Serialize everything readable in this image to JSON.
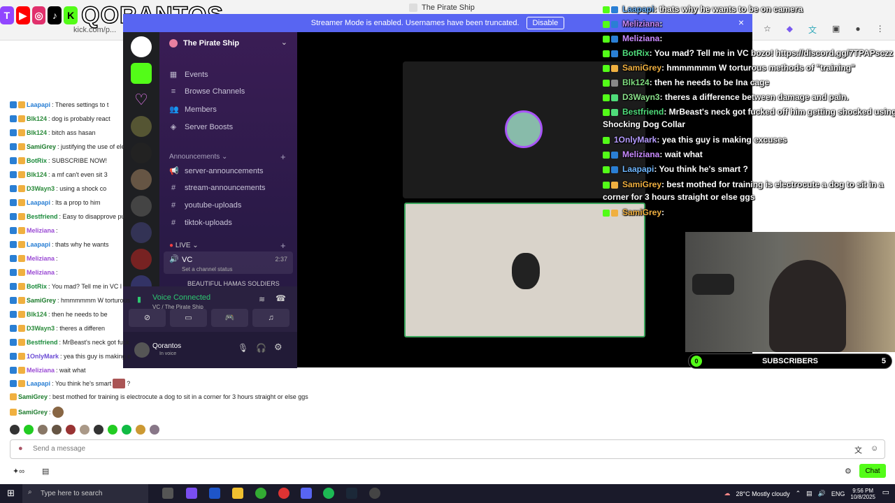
{
  "browser": {
    "url": "kick.com/p...",
    "window_title": "The Pirate Ship"
  },
  "brand": {
    "name": "QORANTOS"
  },
  "discord": {
    "banner_text": "Streamer Mode is enabled. Usernames have been truncated.",
    "banner_button": "Disable",
    "banner_close": "×",
    "server_name": "The Pirate Ship",
    "menu": [
      "Events",
      "Browse Channels",
      "Members",
      "Server Boosts"
    ],
    "announcements_label": "Announcements",
    "channels": [
      "server-announcements",
      "stream-announcements",
      "youtube-uploads",
      "tiktok-uploads"
    ],
    "live_label": "LIVE",
    "vc_name": "VC",
    "vc_time": "2:37",
    "vc_status": "Set a channel status",
    "vc_member": "BEAUTIFUL HAMAS SOLDIERS",
    "voice_connected": "Voice Connected",
    "voice_location": "VC / The Pirate Ship",
    "user_name": "Qorantos",
    "user_status": "In voice"
  },
  "overlay_chat": [
    {
      "user": "Laapapi",
      "msg": ": thats why he wants to be on camera",
      "color": "#6fb7ff"
    },
    {
      "user": "Meliziana",
      "msg": ":",
      "color": "#c98aff"
    },
    {
      "user": "Meliziana",
      "msg": ":",
      "color": "#c98aff"
    },
    {
      "user": "BotRix",
      "msg": ": You mad? Tell me in VC bozo! https://discord.gg/7TPAPsczz",
      "color": "#4fdc7a"
    },
    {
      "user": "SamiGrey",
      "msg": ": hmmmmmm W torturous methods of \"training\"",
      "color": "#f0b040"
    },
    {
      "user": "Blk124",
      "msg": ": then he needs to be Ina cage",
      "color": "#7fdc7f"
    },
    {
      "user": "D3Wayn3",
      "msg": ": theres a difference between damage and pain.",
      "color": "#8ae08a"
    },
    {
      "user": "Bestfriend",
      "msg": ": MrBeast's neck got fucked off him getting shocked using a",
      "color": "#4fdc7a"
    },
    {
      "user": "",
      "msg": "Shocking Dog Collar",
      "color": "#ffffff"
    },
    {
      "user": "1OnlyMark",
      "msg": ": yea this guy is making excuses",
      "color": "#b69cff"
    },
    {
      "user": "Meliziana",
      "msg": ": wait what",
      "color": "#c98aff"
    },
    {
      "user": "Laapapi",
      "msg": ": You think he's smart",
      "color": "#6fb7ff"
    },
    {
      "user": "SamiGrey",
      "msg": ": best mothed for training is electrocute a dog to sit in a",
      "color": "#f0b040"
    },
    {
      "user": "",
      "msg": "corner for 3 hours straight or else ggs",
      "color": "#ffffff"
    },
    {
      "user": "SamiGrey",
      "msg": ":",
      "color": "#f0b040"
    }
  ],
  "chat": [
    {
      "user": "Laapapi",
      "msg": ": Theres settings to t",
      "color": "#2a7fd4"
    },
    {
      "user": "Blk124",
      "msg": ": dog is probably react",
      "color": "#2a8a3a"
    },
    {
      "user": "Blk124",
      "msg": ": bitch ass hasan",
      "color": "#2a8a3a"
    },
    {
      "user": "SamiGrey",
      "msg": ": justifying the use of elec",
      "color": "#1a7a2a"
    },
    {
      "user": "BotRix",
      "msg": ": SUBSCRIBE NOW!",
      "color": "#1a8a3a"
    },
    {
      "user": "Blk124",
      "msg": ": a mf can't even sit 3",
      "color": "#2a8a3a"
    },
    {
      "user": "D3Wayn3",
      "msg": ": using a shock co",
      "color": "#2a8a3a"
    },
    {
      "user": "Laapapi",
      "msg": ": Its a prop to him",
      "color": "#2a7fd4"
    },
    {
      "user": "Bestfriend",
      "msg": ": Easy to disapprove pull",
      "color": "#1a8a3a"
    },
    {
      "user": "Meliziana",
      "msg": ":",
      "color": "#9a4ad4"
    },
    {
      "user": "Laapapi",
      "msg": ": thats why he wants",
      "color": "#2a7fd4"
    },
    {
      "user": "Meliziana",
      "msg": ":",
      "color": "#9a4ad4"
    },
    {
      "user": "Meliziana",
      "msg": ":",
      "color": "#9a4ad4"
    },
    {
      "user": "BotRix",
      "msg": ": You mad? Tell me in VC l",
      "color": "#1a8a3a"
    },
    {
      "user": "SamiGrey",
      "msg": ": hmmmmmm W torturous",
      "color": "#1a7a2a"
    },
    {
      "user": "Blk124",
      "msg": ": then he needs to be",
      "color": "#2a8a3a"
    },
    {
      "user": "D3Wayn3",
      "msg": ": theres a differen",
      "color": "#2a8a3a"
    },
    {
      "user": "Bestfriend",
      "msg": ": MrBeast's neck got fuck",
      "color": "#1a8a3a"
    },
    {
      "user": "1OnlyMark",
      "msg": ": yea this guy is making e",
      "color": "#6a4ad4"
    },
    {
      "user": "Meliziana",
      "msg": ": wait what",
      "color": "#9a4ad4"
    }
  ],
  "chat_full": [
    {
      "user": "Laapapi",
      "msg": ": You think he's smart",
      "tail": "?",
      "color": "#2a7fd4"
    },
    {
      "user": "SamiGrey",
      "msg": ": best mothed for training is electrocute a dog to sit in a corner for 3 hours straight or else ggs",
      "tail": "",
      "color": "#1a7a2a"
    },
    {
      "user": "SamiGrey",
      "msg": ":",
      "tail": "",
      "color": "#1a7a2a"
    }
  ],
  "input": {
    "placeholder": "Send a message"
  },
  "chat_button": "Chat",
  "subscribers": {
    "left": "0",
    "label": "SUBSCRIBERS",
    "right": "5"
  },
  "taskbar": {
    "search": "Type here to search",
    "weather": "28°C  Mostly cloudy",
    "lang": "ENG",
    "time": "9:56 PM",
    "date": "10/8/2025"
  }
}
